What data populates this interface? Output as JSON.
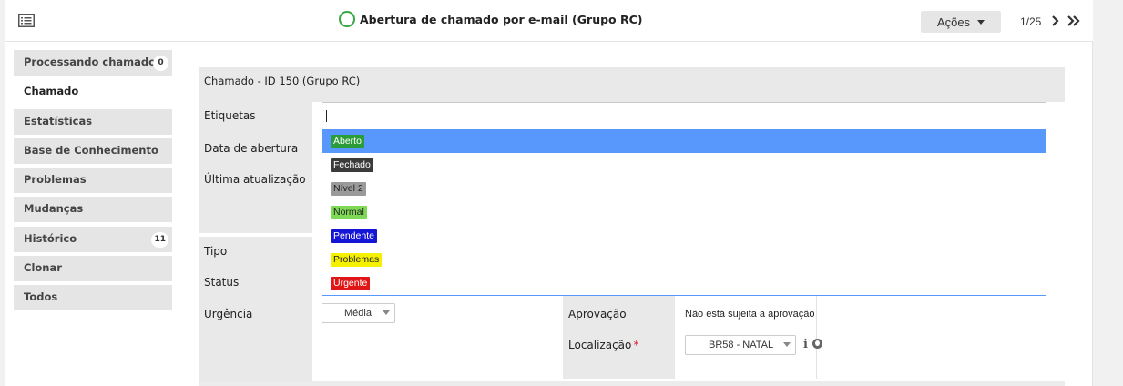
{
  "header": {
    "title": "Abertura de chamado por e-mail (Grupo RC)",
    "actions_label": "Ações",
    "pager": "1/25"
  },
  "sidebar": {
    "items": [
      {
        "label": "Processando chamado",
        "badge": "0"
      },
      {
        "label": "Chamado",
        "badge": ""
      },
      {
        "label": "Estatísticas",
        "badge": ""
      },
      {
        "label": "Base de Conhecimento",
        "badge": ""
      },
      {
        "label": "Problemas",
        "badge": ""
      },
      {
        "label": "Mudanças",
        "badge": ""
      },
      {
        "label": "Histórico",
        "badge": "11"
      },
      {
        "label": "Clonar",
        "badge": ""
      },
      {
        "label": "Todos",
        "badge": ""
      }
    ]
  },
  "ticket": {
    "section_title": "Chamado - ID 150 (Grupo RC)",
    "labels": {
      "tags": "Etiquetas",
      "opened": "Data de abertura",
      "updated": "Última atualização",
      "type": "Tipo",
      "status": "Status",
      "urgency": "Urgência",
      "approval": "Aprovação",
      "location": "Localização"
    },
    "urgency_value": "Média",
    "approval_value": "Não está sujeita a aprovação",
    "location_value": "BR58 - NATAL",
    "required_mark": "*"
  },
  "tag_options": [
    {
      "label": "Aberto",
      "bg": "#2a9d3a",
      "fg": "#ffffff"
    },
    {
      "label": "Fechado",
      "bg": "#3b3b3b",
      "fg": "#ffffff"
    },
    {
      "label": "Nível 2",
      "bg": "#9a9a9a",
      "fg": "#222222"
    },
    {
      "label": "Normal",
      "bg": "#7ed957",
      "fg": "#222222"
    },
    {
      "label": "Pendente",
      "bg": "#1515d6",
      "fg": "#ffffff"
    },
    {
      "label": "Problemas",
      "bg": "#f5f000",
      "fg": "#222222"
    },
    {
      "label": "Urgente",
      "bg": "#e01515",
      "fg": "#ffffff"
    }
  ],
  "icons": [
    "list-icon",
    "status-circle-icon",
    "chevron-down-icon",
    "next-icon",
    "last-page-icon",
    "info-icon",
    "globe-icon"
  ],
  "colors": {
    "highlight": "#5897fb",
    "status_circle": "#3aa845"
  }
}
